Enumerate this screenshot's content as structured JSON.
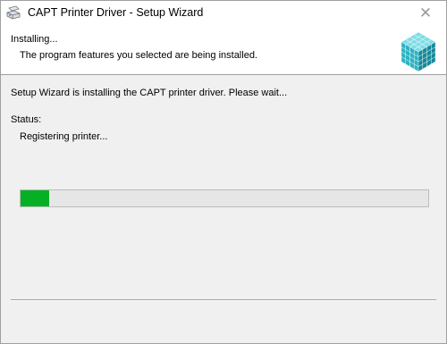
{
  "window": {
    "title": "CAPT Printer Driver - Setup Wizard",
    "close_glyph": "✕",
    "app_icon": "printer-icon"
  },
  "header": {
    "heading": "Installing...",
    "subheading": "The program features you selected are being installed.",
    "logo_icon": "installer-cube-icon"
  },
  "content": {
    "message": "Setup Wizard is installing the CAPT printer driver. Please wait...",
    "status_label": "Status:",
    "status_text": "Registering printer..."
  },
  "progress": {
    "value_percent": 7,
    "fill_color": "#06b025"
  },
  "colors": {
    "window_bg": "#f0f0f0",
    "header_bg": "#ffffff",
    "logo_teal": "#2bb3c3"
  }
}
